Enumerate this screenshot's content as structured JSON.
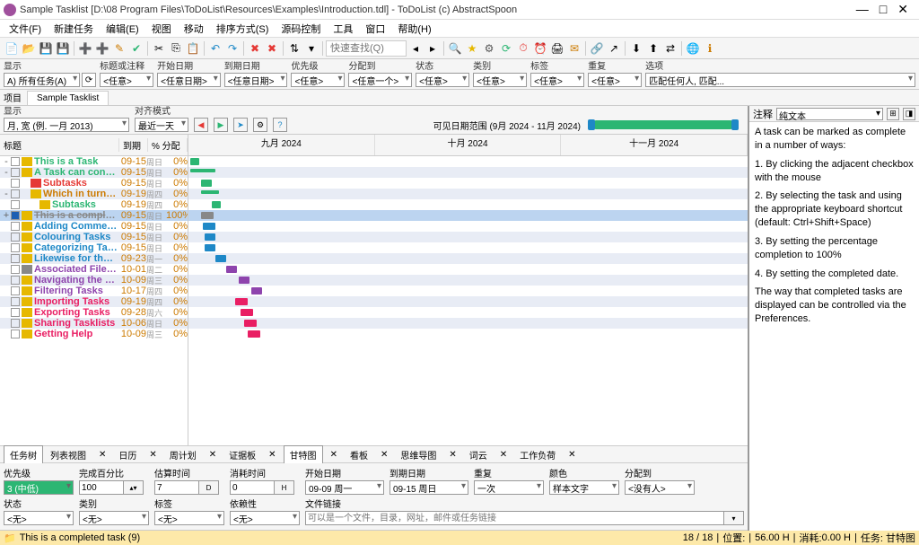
{
  "window_title": "Sample Tasklist [D:\\08 Program Files\\ToDoList\\Resources\\Examples\\Introduction.tdl] - ToDoList (c) AbstractSpoon",
  "menu": [
    "文件(F)",
    "新建任务",
    "编辑(E)",
    "视图",
    "移动",
    "排序方式(S)",
    "源码控制",
    "工具",
    "窗口",
    "帮助(H)"
  ],
  "quicksearch_placeholder": "快速查找(Q)",
  "filter": {
    "display_label": "显示",
    "display_value": "A) 所有任务(A)",
    "title_label": "标题或注释",
    "title_value": "<任意>",
    "start_label": "开始日期",
    "start_value": "<任意日期>",
    "due_label": "到期日期",
    "due_value": "<任意日期>",
    "priority_label": "优先级",
    "priority_value": "<任意>",
    "alloc_label": "分配到",
    "alloc_value": "<任意一个>",
    "status_label": "状态",
    "status_value": "<任意>",
    "cat_label": "类别",
    "cat_value": "<任意>",
    "tag_label": "标签",
    "tag_value": "<任意>",
    "repeat_label": "重复",
    "repeat_value": "<任意>",
    "opt_label": "选项",
    "opt_value": "匹配任何人, 匹配..."
  },
  "project_label": "项目",
  "project_tab": "Sample Tasklist",
  "gantt": {
    "disp_label": "显示",
    "disp_value": "月, 宽         (例. 一月 2013)",
    "align_label": "对齐模式",
    "align_value": "最近一天",
    "range_label": "可见日期范围 (9月 2024 - 11月 2024)",
    "months": [
      "九月 2024",
      "十月 2024",
      "十一月 2024"
    ],
    "head_cols": {
      "title": "标题",
      "due": "到期",
      "pct": "% 分配"
    }
  },
  "tasks": [
    {
      "lvl": 0,
      "exp": "-",
      "name": "This is a Task",
      "color": "#2cb673",
      "date": "09-15",
      "day": "周日",
      "pct": "0%",
      "bar": {
        "l": 2,
        "w": 10,
        "c": "#2cb673"
      }
    },
    {
      "lvl": 0,
      "exp": "-",
      "name": "A Task can contain...",
      "color": "#2cb673",
      "date": "09-15",
      "day": "周日",
      "pct": "0%",
      "bar": {
        "l": 2,
        "w": 28,
        "c": "#2cb673",
        "summary": true
      }
    },
    {
      "lvl": 1,
      "exp": "",
      "name": "Subtasks",
      "color": "#e53935",
      "ico": "x",
      "date": "09-15",
      "day": "周日",
      "pct": "0%",
      "bar": {
        "l": 14,
        "w": 12,
        "c": "#2cb673"
      }
    },
    {
      "lvl": 1,
      "exp": "-",
      "name": "Which in turn can ...",
      "color": "#cc7a00",
      "date": "09-19",
      "day": "周四",
      "pct": "0%",
      "bar": {
        "l": 14,
        "w": 20,
        "c": "#2cb673",
        "summary": true
      }
    },
    {
      "lvl": 2,
      "exp": "",
      "name": "Subtasks",
      "color": "#2cb673",
      "date": "09-19",
      "day": "周四",
      "pct": "0%",
      "bar": {
        "l": 26,
        "w": 10,
        "c": "#2cb673"
      }
    },
    {
      "lvl": 0,
      "exp": "+",
      "name": "This is a completed ...",
      "color": "#888",
      "strike": true,
      "done": true,
      "date": "09-15",
      "day": "周日",
      "pct": "100%",
      "bar": {
        "l": 14,
        "w": 14,
        "c": "#888",
        "sel": true
      }
    },
    {
      "lvl": 0,
      "exp": "",
      "name": "Adding Comments t...",
      "color": "#1e88c7",
      "date": "09-15",
      "day": "周日",
      "pct": "0%",
      "bar": {
        "l": 16,
        "w": 14,
        "c": "#1e88c7"
      }
    },
    {
      "lvl": 0,
      "exp": "",
      "name": "Colouring Tasks",
      "color": "#1e88c7",
      "date": "09-15",
      "day": "周日",
      "pct": "0%",
      "bar": {
        "l": 18,
        "w": 12,
        "c": "#1e88c7"
      }
    },
    {
      "lvl": 0,
      "exp": "",
      "name": "Categorizing Tasks",
      "color": "#1e88c7",
      "ico": "star",
      "date": "09-15",
      "day": "周日",
      "pct": "0%",
      "bar": {
        "l": 18,
        "w": 12,
        "c": "#1e88c7"
      }
    },
    {
      "lvl": 0,
      "exp": "",
      "name": "Likewise for the tas...",
      "color": "#1e88c7",
      "ico": "star",
      "date": "09-23",
      "day": "周一",
      "pct": "0%",
      "bar": {
        "l": 30,
        "w": 12,
        "c": "#1e88c7"
      }
    },
    {
      "lvl": 0,
      "exp": "",
      "name": "Associated Files wit...",
      "color": "#8e44ad",
      "ico": "clip",
      "date": "10-01",
      "day": "周二",
      "pct": "0%",
      "bar": {
        "l": 42,
        "w": 12,
        "c": "#8e44ad"
      }
    },
    {
      "lvl": 0,
      "exp": "",
      "name": "Navigating the Tas...",
      "color": "#8e44ad",
      "date": "10-09",
      "day": "周三",
      "pct": "0%",
      "bar": {
        "l": 56,
        "w": 12,
        "c": "#8e44ad"
      }
    },
    {
      "lvl": 0,
      "exp": "",
      "name": "Filtering Tasks",
      "color": "#8e44ad",
      "date": "10-17",
      "day": "周四",
      "pct": "0%",
      "bar": {
        "l": 70,
        "w": 12,
        "c": "#8e44ad"
      }
    },
    {
      "lvl": 0,
      "exp": "",
      "name": "Importing Tasks",
      "color": "#e91e63",
      "date": "09-19",
      "day": "周四",
      "pct": "0%",
      "bar": {
        "l": 52,
        "w": 14,
        "c": "#e91e63"
      }
    },
    {
      "lvl": 0,
      "exp": "",
      "name": "Exporting Tasks",
      "color": "#e91e63",
      "date": "09-28",
      "day": "周六",
      "pct": "0%",
      "bar": {
        "l": 58,
        "w": 14,
        "c": "#e91e63"
      }
    },
    {
      "lvl": 0,
      "exp": "",
      "name": "Sharing Tasklists",
      "color": "#e91e63",
      "date": "10-06",
      "day": "周日",
      "pct": "0%",
      "bar": {
        "l": 62,
        "w": 14,
        "c": "#e91e63"
      }
    },
    {
      "lvl": 0,
      "exp": "",
      "name": "Getting Help",
      "color": "#e91e63",
      "date": "10-09",
      "day": "周三",
      "pct": "0%",
      "bar": {
        "l": 66,
        "w": 14,
        "c": "#e91e63"
      }
    }
  ],
  "viewtabs": [
    {
      "label": "任务树",
      "active": true
    },
    {
      "label": "列表视图"
    },
    {
      "label": "✕"
    },
    {
      "label": "日历"
    },
    {
      "label": "✕"
    },
    {
      "label": "周计划"
    },
    {
      "label": "✕"
    },
    {
      "label": "证据板"
    },
    {
      "label": "✕"
    },
    {
      "label": "甘特图",
      "active": true
    },
    {
      "label": "✕"
    },
    {
      "label": "看板"
    },
    {
      "label": "✕"
    },
    {
      "label": "思维导图"
    },
    {
      "label": "✕"
    },
    {
      "label": "词云"
    },
    {
      "label": "✕"
    },
    {
      "label": "工作负荷"
    },
    {
      "label": "✕"
    }
  ],
  "props": {
    "priority_label": "优先级",
    "priority_value": "3 (中低)",
    "pct_label": "完成百分比",
    "pct_value": "100",
    "est_label": "估算时间",
    "est_value": "7",
    "est_unit": "D",
    "spent_label": "消耗时间",
    "spent_value": "0",
    "spent_unit": "H",
    "start_label": "开始日期",
    "start_value": "09-09 周一",
    "due_label": "到期日期",
    "due_value": "09-15 周日",
    "repeat_label": "重复",
    "repeat_value": "一次",
    "color_label": "颜色",
    "color_value": "样本文字",
    "alloc_label": "分配到",
    "alloc_value": "<没有人>",
    "status_label": "状态",
    "status_value": "<无>",
    "cat_label": "类别",
    "cat_value": "<无>",
    "tag_label": "标签",
    "tag_value": "<无>",
    "dep_label": "依赖性",
    "dep_value": "<无>",
    "link_label": "文件链接",
    "link_placeholder": "可以是一个文件，目录，网址，邮件或任务链接"
  },
  "status": {
    "task": "This is a completed task   (9)",
    "count": "18 / 18",
    "pos": "位置:",
    "spent": "56.00 H",
    "rem": "消耗:",
    "est": "0.00 H",
    "assign": "任务: 甘特图"
  },
  "comments": {
    "label": "注释",
    "format": "纯文本",
    "body": [
      "A task can be marked as complete in a number of ways:",
      "1. By clicking the adjacent checkbox with the mouse",
      "2. By selecting the task and using the appropriate keyboard shortcut (default: Ctrl+Shift+Space)",
      "3. By setting the percentage completion to 100%",
      "4. By setting the completed date.",
      "The way that completed tasks are displayed can be controlled via the Preferences."
    ]
  }
}
